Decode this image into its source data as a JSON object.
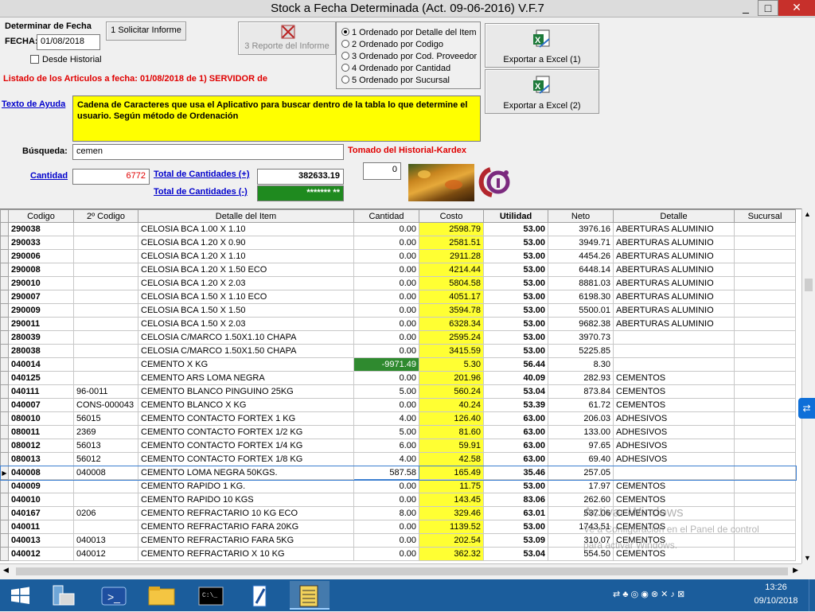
{
  "window": {
    "title": "Stock a Fecha Determinada (Act. 09-06-2016)  V.F.7"
  },
  "header": {
    "determinar_label": "Determinar de Fecha",
    "fecha_label": "FECHA:",
    "fecha_value": "01/08/2018",
    "desde_historial": "Desde Historial",
    "solicitar_button": "1 Solicitar Informe",
    "reporte_button": "3 Reporte del Informe",
    "listado_text": "Listado de los Articulos a fecha: 01/08/2018 de 1) SERVIDOR de",
    "export1": "Exportar a Excel (1)",
    "export2": "Exportar a Excel (2)"
  },
  "ordering": {
    "options": [
      "1 Ordenado por Detalle del Item",
      "2 Ordenado por Codigo",
      "3 Ordenado por Cod. Proveedor",
      "4 Ordenado por Cantidad",
      "5 Ordenado por Sucursal"
    ],
    "selected_index": 0
  },
  "help": {
    "link": "Texto de Ayuda",
    "text": "Cadena de Caracteres que usa el Aplicativo para buscar dentro de la tabla lo que determine el usuario. Según método de Ordenación"
  },
  "search": {
    "label": "Búsqueda:",
    "value": "cemen",
    "tomado": "Tomado del Historial-Kardex",
    "count_value": "0"
  },
  "totals": {
    "cantidad_link": "Cantidad",
    "cantidad_value": "6772",
    "total_pos_link": "Total de Cantidades (+)",
    "total_pos_value": "382633.19",
    "total_neg_link": "Total de Cantidades (-)",
    "total_neg_value": "******* **"
  },
  "table": {
    "columns": [
      "Codigo",
      "2º Codigo",
      "Detalle del Item",
      "Cantidad",
      "Costo",
      "Utilidad",
      "Neto",
      "Detalle",
      "Sucursal"
    ],
    "rows": [
      [
        "290038",
        "",
        "CELOSIA BCA 1.00 X 1.10",
        "0.00",
        "2598.79",
        "53.00",
        "3976.16",
        "ABERTURAS ALUMINIO",
        ""
      ],
      [
        "290033",
        "",
        "CELOSIA BCA 1.20 X 0.90",
        "0.00",
        "2581.51",
        "53.00",
        "3949.71",
        "ABERTURAS ALUMINIO",
        ""
      ],
      [
        "290006",
        "",
        "CELOSIA BCA 1.20 X 1.10",
        "0.00",
        "2911.28",
        "53.00",
        "4454.26",
        "ABERTURAS ALUMINIO",
        ""
      ],
      [
        "290008",
        "",
        "CELOSIA BCA 1.20 X 1.50 ECO",
        "0.00",
        "4214.44",
        "53.00",
        "6448.14",
        "ABERTURAS ALUMINIO",
        ""
      ],
      [
        "290010",
        "",
        "CELOSIA BCA 1.20 X 2.03",
        "0.00",
        "5804.58",
        "53.00",
        "8881.03",
        "ABERTURAS ALUMINIO",
        ""
      ],
      [
        "290007",
        "",
        "CELOSIA BCA 1.50 X 1.10 ECO",
        "0.00",
        "4051.17",
        "53.00",
        "6198.30",
        "ABERTURAS ALUMINIO",
        ""
      ],
      [
        "290009",
        "",
        "CELOSIA BCA 1.50 X 1.50",
        "0.00",
        "3594.78",
        "53.00",
        "5500.01",
        "ABERTURAS ALUMINIO",
        ""
      ],
      [
        "290011",
        "",
        "CELOSIA BCA 1.50 X 2.03",
        "0.00",
        "6328.34",
        "53.00",
        "9682.38",
        "ABERTURAS ALUMINIO",
        ""
      ],
      [
        "280039",
        "",
        "CELOSIA C/MARCO 1.50X1.10 CHAPA",
        "0.00",
        "2595.24",
        "53.00",
        "3970.73",
        "",
        ""
      ],
      [
        "280038",
        "",
        "CELOSIA C/MARCO 1.50X1.50 CHAPA",
        "0.00",
        "3415.59",
        "53.00",
        "5225.85",
        "",
        ""
      ],
      [
        "040014",
        "",
        "CEMENTO  X KG",
        "-9971.49",
        "5.30",
        "56.44",
        "8.30",
        "",
        ""
      ],
      [
        "040125",
        "",
        "CEMENTO ARS LOMA NEGRA",
        "0.00",
        "201.96",
        "40.09",
        "282.93",
        "CEMENTOS",
        ""
      ],
      [
        "040111",
        "96-0011",
        "CEMENTO BLANCO PINGUINO 25KG",
        "5.00",
        "560.24",
        "53.04",
        "873.84",
        "CEMENTOS",
        ""
      ],
      [
        "040007",
        "CONS-000043",
        "CEMENTO BLANCO X KG",
        "0.00",
        "40.24",
        "53.39",
        "61.72",
        "CEMENTOS",
        ""
      ],
      [
        "080010",
        "56015",
        "CEMENTO CONTACTO FORTEX 1 KG",
        "4.00",
        "126.40",
        "63.00",
        "206.03",
        "ADHESIVOS",
        ""
      ],
      [
        "080011",
        "2369",
        "CEMENTO CONTACTO FORTEX 1/2 KG",
        "5.00",
        "81.60",
        "63.00",
        "133.00",
        "ADHESIVOS",
        ""
      ],
      [
        "080012",
        "56013",
        "CEMENTO CONTACTO FORTEX 1/4 KG",
        "6.00",
        "59.91",
        "63.00",
        "97.65",
        "ADHESIVOS",
        ""
      ],
      [
        "080013",
        "56012",
        "CEMENTO CONTACTO FORTEX 1/8 KG",
        "4.00",
        "42.58",
        "63.00",
        "69.40",
        "ADHESIVOS",
        ""
      ],
      [
        "040008",
        "040008",
        "CEMENTO LOMA NEGRA 50KGS.",
        "587.58",
        "165.49",
        "35.46",
        "257.05",
        "",
        ""
      ],
      [
        "040009",
        "",
        "CEMENTO RAPIDO 1 KG.",
        "0.00",
        "11.75",
        "53.00",
        "17.97",
        "CEMENTOS",
        ""
      ],
      [
        "040010",
        "",
        "CEMENTO RAPIDO 10 KGS",
        "0.00",
        "143.45",
        "83.06",
        "262.60",
        "CEMENTOS",
        ""
      ],
      [
        "040167",
        "0206",
        "CEMENTO REFRACTARIO 10 KG ECO",
        "8.00",
        "329.46",
        "63.01",
        "537.06",
        "CEMENTOS",
        ""
      ],
      [
        "040011",
        "",
        "CEMENTO REFRACTARIO FARA 20KG",
        "0.00",
        "1139.52",
        "53.00",
        "1743.51",
        "CEMENTOS",
        ""
      ],
      [
        "040013",
        "040013",
        "CEMENTO REFRACTARIO FARA 5KG",
        "0.00",
        "202.54",
        "53.09",
        "310.07",
        "CEMENTOS",
        ""
      ],
      [
        "040012",
        "040012",
        "CEMENTO REFRACTARIO X 10 KG",
        "0.00",
        "362.32",
        "53.04",
        "554.50",
        "CEMENTOS",
        ""
      ]
    ],
    "negative_row": 10,
    "current_row": 18
  },
  "watermark": {
    "line1": "Activar Windows",
    "line2": "Ve a Configuración en el Panel de control",
    "line3": "para activar Windows."
  },
  "taskbar": {
    "time": "13:26",
    "date": "09/10/2018"
  }
}
